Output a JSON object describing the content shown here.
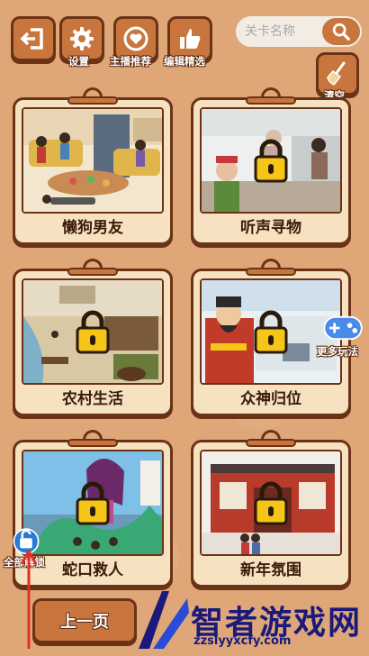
{
  "toolbar": {
    "back_label": "",
    "settings_label": "设置",
    "streamer_label": "主播推荐",
    "editor_label": "编辑精选",
    "clear_label": "清空"
  },
  "search": {
    "placeholder": "关卡名称"
  },
  "levels": [
    {
      "name": "懒狗男友",
      "locked": false
    },
    {
      "name": "听声寻物",
      "locked": true
    },
    {
      "name": "农村生活",
      "locked": true
    },
    {
      "name": "众神归位",
      "locked": true
    },
    {
      "name": "蛇口救人",
      "locked": true
    },
    {
      "name": "新年氛围",
      "locked": true
    }
  ],
  "side": {
    "more_games_label": "更多玩法",
    "unlock_all_label": "全部解锁"
  },
  "pager": {
    "prev_label": "上一页"
  },
  "watermark": {
    "text": "智者游戏网",
    "url": "zzslyyxcfy.com"
  },
  "colors": {
    "background": "#dfa777",
    "button": "#c9753e",
    "border": "#6b3316",
    "card": "#f6e1c1",
    "lock": "#f5c518"
  }
}
